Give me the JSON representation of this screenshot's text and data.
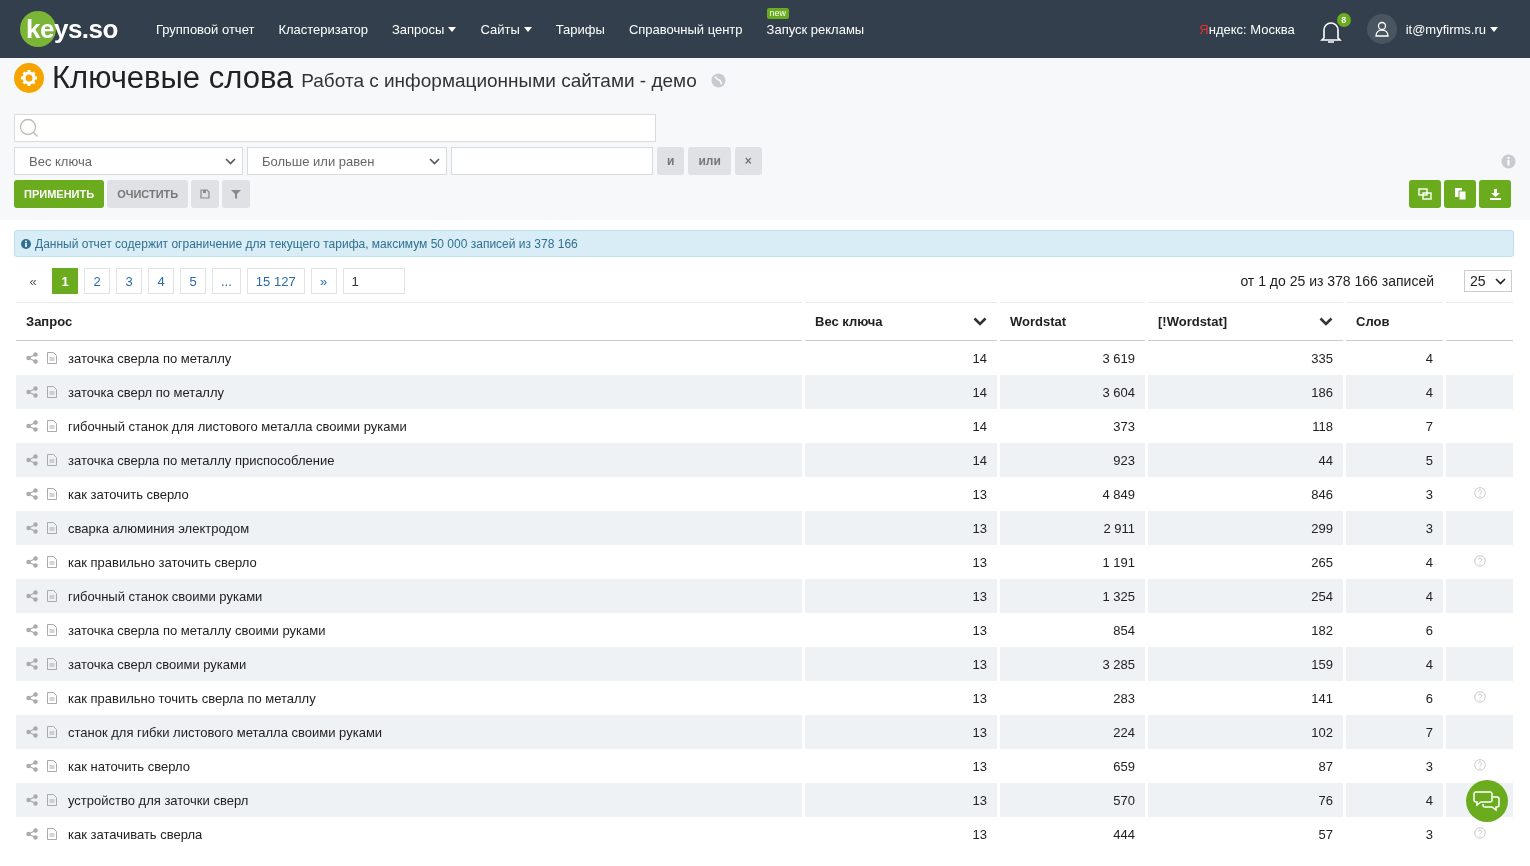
{
  "nav": {
    "logo": "keys.so",
    "items": [
      {
        "label": "Групповой отчет",
        "dropdown": false
      },
      {
        "label": "Кластеризатор",
        "dropdown": false
      },
      {
        "label": "Запросы",
        "dropdown": true
      },
      {
        "label": "Сайты",
        "dropdown": true
      },
      {
        "label": "Тарифы",
        "dropdown": false
      },
      {
        "label": "Справочный центр",
        "dropdown": false
      },
      {
        "label": "Запуск рекламы",
        "dropdown": false,
        "badge": "new"
      }
    ],
    "region": "Яндекс: Москва",
    "notifications": "8",
    "user": "it@myfirms.ru"
  },
  "header": {
    "title": "Ключевые слова",
    "subtitle": "Работа с информационными сайтами - демо"
  },
  "filter": {
    "field": "Вес ключа",
    "operator": "Больше или равен",
    "and": "и",
    "or": "или",
    "remove": "×",
    "apply": "ПРИМЕНИТЬ",
    "clear": "ОЧИСТИТЬ"
  },
  "notice": "Данный отчет содержит ограничение для текущего тарифа, максимум 50 000 записей из 378 166",
  "pagination": {
    "prev": "«",
    "next": "»",
    "goto": "1",
    "summary": "от 1 до 25 из 378 166 записей",
    "page_size": "25",
    "pages": [
      {
        "label": "1",
        "selected": true
      },
      {
        "label": "2",
        "selected": false
      },
      {
        "label": "3",
        "selected": false
      },
      {
        "label": "4",
        "selected": false
      },
      {
        "label": "5",
        "selected": false
      },
      {
        "label": "...",
        "selected": false
      },
      {
        "label": "15 127",
        "selected": false
      }
    ]
  },
  "table": {
    "columns": [
      {
        "label": "Запрос",
        "sortable": false
      },
      {
        "label": "Вес ключа",
        "sortable": true
      },
      {
        "label": "Wordstat",
        "sortable": false
      },
      {
        "label": "[!Wordstat]",
        "sortable": true
      },
      {
        "label": "Слов",
        "sortable": false
      }
    ],
    "rows": [
      {
        "query": "заточка сверла по металлу",
        "weight": "14",
        "wordstat": "3 619",
        "exact": "335",
        "words": "4",
        "help": false
      },
      {
        "query": "заточка сверл по металлу",
        "weight": "14",
        "wordstat": "3 604",
        "exact": "186",
        "words": "4",
        "help": false
      },
      {
        "query": "гибочный станок для листового металла своими руками",
        "weight": "14",
        "wordstat": "373",
        "exact": "118",
        "words": "7",
        "help": false
      },
      {
        "query": "заточка сверла по металлу приспособление",
        "weight": "14",
        "wordstat": "923",
        "exact": "44",
        "words": "5",
        "help": false
      },
      {
        "query": "как заточить сверло",
        "weight": "13",
        "wordstat": "4 849",
        "exact": "846",
        "words": "3",
        "help": true
      },
      {
        "query": "сварка алюминия электродом",
        "weight": "13",
        "wordstat": "2 911",
        "exact": "299",
        "words": "3",
        "help": false
      },
      {
        "query": "как правильно заточить сверло",
        "weight": "13",
        "wordstat": "1 191",
        "exact": "265",
        "words": "4",
        "help": true
      },
      {
        "query": "гибочный станок своими руками",
        "weight": "13",
        "wordstat": "1 325",
        "exact": "254",
        "words": "4",
        "help": false
      },
      {
        "query": "заточка сверла по металлу своими руками",
        "weight": "13",
        "wordstat": "854",
        "exact": "182",
        "words": "6",
        "help": false
      },
      {
        "query": "заточка сверл своими руками",
        "weight": "13",
        "wordstat": "3 285",
        "exact": "159",
        "words": "4",
        "help": false
      },
      {
        "query": "как правильно точить сверла по металлу",
        "weight": "13",
        "wordstat": "283",
        "exact": "141",
        "words": "6",
        "help": true
      },
      {
        "query": "станок для гибки листового металла своими руками",
        "weight": "13",
        "wordstat": "224",
        "exact": "102",
        "words": "7",
        "help": false
      },
      {
        "query": "как наточить сверло",
        "weight": "13",
        "wordstat": "659",
        "exact": "87",
        "words": "3",
        "help": true
      },
      {
        "query": "устройство для заточки сверл",
        "weight": "13",
        "wordstat": "570",
        "exact": "76",
        "words": "4",
        "help": false
      },
      {
        "query": "как затачивать сверла",
        "weight": "13",
        "wordstat": "444",
        "exact": "57",
        "words": "3",
        "help": true
      }
    ]
  }
}
